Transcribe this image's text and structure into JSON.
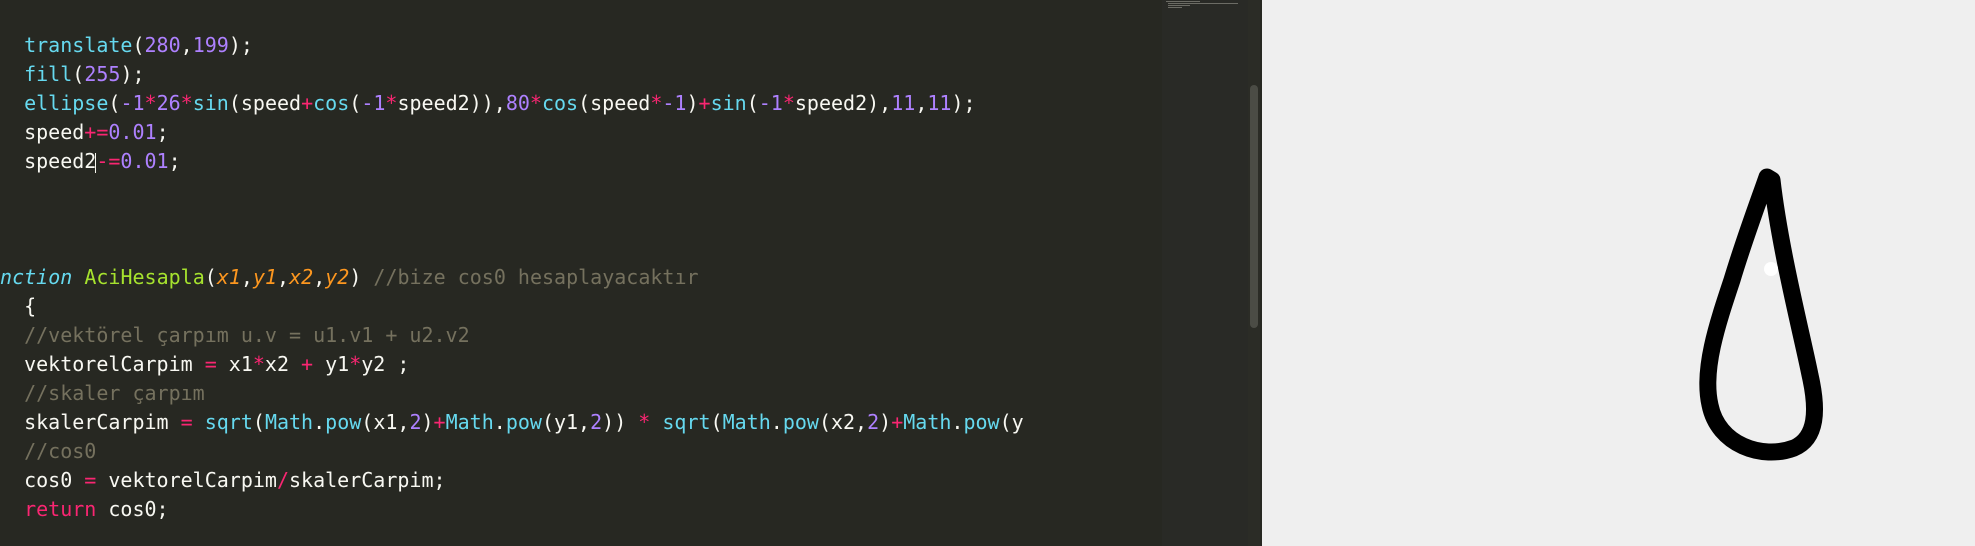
{
  "editor": {
    "lines": [
      {
        "row": 0,
        "tokens": [
          {
            "t": "  ",
            "c": "plain"
          },
          {
            "t": "translate",
            "c": "fn"
          },
          {
            "t": "(",
            "c": "plain"
          },
          {
            "t": "280",
            "c": "num"
          },
          {
            "t": ",",
            "c": "plain"
          },
          {
            "t": "199",
            "c": "num"
          },
          {
            "t": ");",
            "c": "plain"
          }
        ]
      },
      {
        "row": 1,
        "tokens": [
          {
            "t": "  ",
            "c": "plain"
          },
          {
            "t": "fill",
            "c": "fn"
          },
          {
            "t": "(",
            "c": "plain"
          },
          {
            "t": "255",
            "c": "num"
          },
          {
            "t": ");",
            "c": "plain"
          }
        ]
      },
      {
        "row": 2,
        "tokens": [
          {
            "t": "  ",
            "c": "plain"
          },
          {
            "t": "ellipse",
            "c": "fn"
          },
          {
            "t": "(",
            "c": "plain"
          },
          {
            "t": "-1",
            "c": "num"
          },
          {
            "t": "*",
            "c": "op"
          },
          {
            "t": "26",
            "c": "num"
          },
          {
            "t": "*",
            "c": "op"
          },
          {
            "t": "sin",
            "c": "fn"
          },
          {
            "t": "(speed",
            "c": "plain"
          },
          {
            "t": "+",
            "c": "op"
          },
          {
            "t": "cos",
            "c": "fn"
          },
          {
            "t": "(",
            "c": "plain"
          },
          {
            "t": "-1",
            "c": "num"
          },
          {
            "t": "*",
            "c": "op"
          },
          {
            "t": "speed2)),",
            "c": "plain"
          },
          {
            "t": "80",
            "c": "num"
          },
          {
            "t": "*",
            "c": "op"
          },
          {
            "t": "cos",
            "c": "fn"
          },
          {
            "t": "(speed",
            "c": "plain"
          },
          {
            "t": "*",
            "c": "op"
          },
          {
            "t": "-1",
            "c": "num"
          },
          {
            "t": ")",
            "c": "plain"
          },
          {
            "t": "+",
            "c": "op"
          },
          {
            "t": "sin",
            "c": "fn"
          },
          {
            "t": "(",
            "c": "plain"
          },
          {
            "t": "-1",
            "c": "num"
          },
          {
            "t": "*",
            "c": "op"
          },
          {
            "t": "speed2),",
            "c": "plain"
          },
          {
            "t": "11",
            "c": "num"
          },
          {
            "t": ",",
            "c": "plain"
          },
          {
            "t": "11",
            "c": "num"
          },
          {
            "t": ");",
            "c": "plain"
          }
        ]
      },
      {
        "row": 3,
        "tokens": [
          {
            "t": "  speed",
            "c": "plain"
          },
          {
            "t": "+=",
            "c": "op"
          },
          {
            "t": "0.01",
            "c": "num"
          },
          {
            "t": ";",
            "c": "plain"
          }
        ]
      },
      {
        "row": 4,
        "tokens": [
          {
            "t": "  speed2",
            "c": "plain"
          },
          {
            "t": "-=",
            "c": "op"
          },
          {
            "t": "0.01",
            "c": "num"
          },
          {
            "t": ";",
            "c": "plain"
          }
        ],
        "cursor_after_token": 0
      },
      {
        "row": 8,
        "tokens": [
          {
            "t": "unction",
            "c": "kw-it"
          },
          {
            "t": " ",
            "c": "plain"
          },
          {
            "t": "AciHesapla",
            "c": "def"
          },
          {
            "t": "(",
            "c": "plain"
          },
          {
            "t": "x1",
            "c": "param"
          },
          {
            "t": ",",
            "c": "plain"
          },
          {
            "t": "y1",
            "c": "param"
          },
          {
            "t": ",",
            "c": "plain"
          },
          {
            "t": "x2",
            "c": "param"
          },
          {
            "t": ",",
            "c": "plain"
          },
          {
            "t": "y2",
            "c": "param"
          },
          {
            "t": ") ",
            "c": "plain"
          },
          {
            "t": "//bize cos0 hesaplayacaktır",
            "c": "comment"
          }
        ]
      },
      {
        "row": 9,
        "tokens": [
          {
            "t": "  {",
            "c": "plain"
          }
        ]
      },
      {
        "row": 10,
        "tokens": [
          {
            "t": "  ",
            "c": "plain"
          },
          {
            "t": "//vektörel çarpım u.v = u1.v1 + u2.v2",
            "c": "comment"
          }
        ]
      },
      {
        "row": 11,
        "tokens": [
          {
            "t": "  vektorelCarpim ",
            "c": "plain"
          },
          {
            "t": "=",
            "c": "op"
          },
          {
            "t": " x1",
            "c": "plain"
          },
          {
            "t": "*",
            "c": "op"
          },
          {
            "t": "x2 ",
            "c": "plain"
          },
          {
            "t": "+",
            "c": "op"
          },
          {
            "t": " y1",
            "c": "plain"
          },
          {
            "t": "*",
            "c": "op"
          },
          {
            "t": "y2 ;",
            "c": "plain"
          }
        ]
      },
      {
        "row": 12,
        "tokens": [
          {
            "t": "  ",
            "c": "plain"
          },
          {
            "t": "//skaler çarpım",
            "c": "comment"
          }
        ]
      },
      {
        "row": 13,
        "tokens": [
          {
            "t": "  skalerCarpim ",
            "c": "plain"
          },
          {
            "t": "=",
            "c": "op"
          },
          {
            "t": " ",
            "c": "plain"
          },
          {
            "t": "sqrt",
            "c": "fn"
          },
          {
            "t": "(",
            "c": "plain"
          },
          {
            "t": "Math",
            "c": "fn"
          },
          {
            "t": ".",
            "c": "plain"
          },
          {
            "t": "pow",
            "c": "fn"
          },
          {
            "t": "(x1,",
            "c": "plain"
          },
          {
            "t": "2",
            "c": "num"
          },
          {
            "t": ")",
            "c": "plain"
          },
          {
            "t": "+",
            "c": "op"
          },
          {
            "t": "Math",
            "c": "fn"
          },
          {
            "t": ".",
            "c": "plain"
          },
          {
            "t": "pow",
            "c": "fn"
          },
          {
            "t": "(y1,",
            "c": "plain"
          },
          {
            "t": "2",
            "c": "num"
          },
          {
            "t": ")) ",
            "c": "plain"
          },
          {
            "t": "*",
            "c": "op"
          },
          {
            "t": " ",
            "c": "plain"
          },
          {
            "t": "sqrt",
            "c": "fn"
          },
          {
            "t": "(",
            "c": "plain"
          },
          {
            "t": "Math",
            "c": "fn"
          },
          {
            "t": ".",
            "c": "plain"
          },
          {
            "t": "pow",
            "c": "fn"
          },
          {
            "t": "(x2,",
            "c": "plain"
          },
          {
            "t": "2",
            "c": "num"
          },
          {
            "t": ")",
            "c": "plain"
          },
          {
            "t": "+",
            "c": "op"
          },
          {
            "t": "Math",
            "c": "fn"
          },
          {
            "t": ".",
            "c": "plain"
          },
          {
            "t": "pow",
            "c": "fn"
          },
          {
            "t": "(y",
            "c": "plain"
          }
        ]
      },
      {
        "row": 14,
        "tokens": [
          {
            "t": "  ",
            "c": "plain"
          },
          {
            "t": "//cos0",
            "c": "comment"
          }
        ]
      },
      {
        "row": 15,
        "tokens": [
          {
            "t": "  cos0 ",
            "c": "plain"
          },
          {
            "t": "=",
            "c": "op"
          },
          {
            "t": " vektorelCarpim",
            "c": "plain"
          },
          {
            "t": "/",
            "c": "op"
          },
          {
            "t": "skalerCarpim;",
            "c": "plain"
          }
        ]
      },
      {
        "row": 16,
        "tokens": [
          {
            "t": "  ",
            "c": "plain"
          },
          {
            "t": "return",
            "c": "op"
          },
          {
            "t": " cos0;",
            "c": "plain"
          }
        ]
      }
    ]
  },
  "colors": {
    "editor_background": "#272822",
    "canvas_background": "#efefef",
    "drawing_stroke": "#000000",
    "drawing_dot": "#ffffff"
  },
  "canvas": {
    "description_icon": "sketch-output"
  }
}
